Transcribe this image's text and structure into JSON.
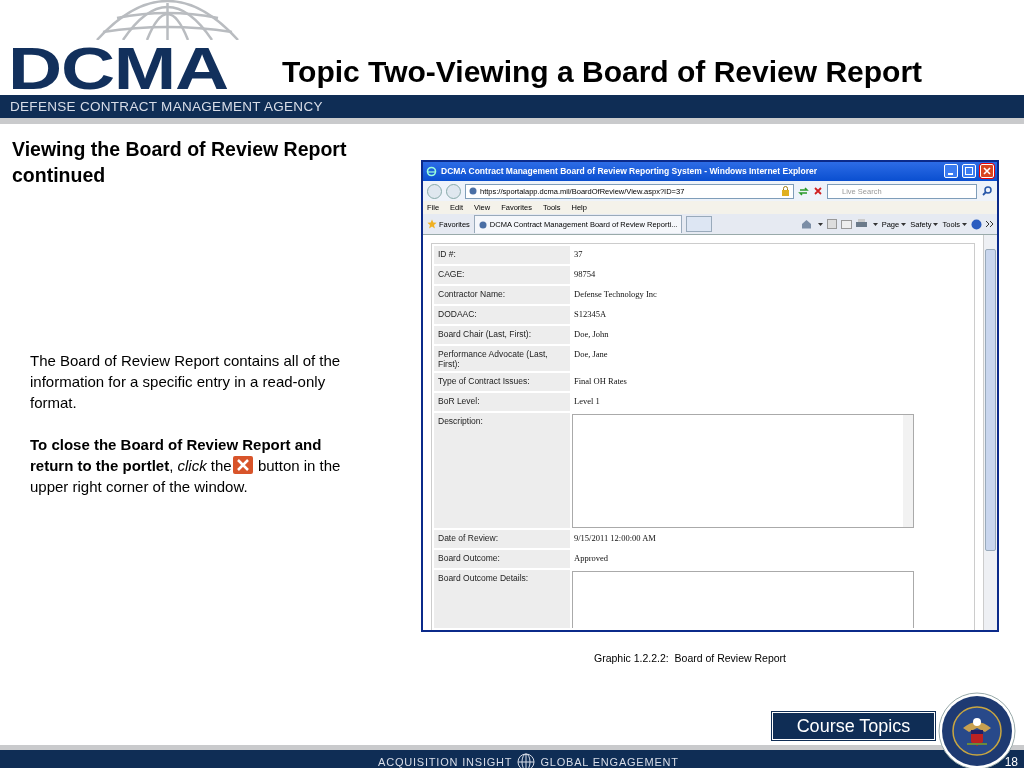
{
  "header": {
    "logo_text": "DCMA",
    "agency": "DEFENSE CONTRACT MANAGEMENT AGENCY",
    "title": "Topic Two-Viewing a Board of Review Report"
  },
  "heading": "Viewing the Board of Review Report continued",
  "intro": "The Board of Review Report contains all of the information for a specific entry in a read-only format.",
  "instruction": {
    "before": [
      "**To close the Board of Review Report and**",
      "**return to the portlet**, *click* the"
    ],
    "after": [
      "button in the",
      "upper right corner of the window."
    ]
  },
  "browser": {
    "title": "DCMA Contract Management Board of Review Reporting System - Windows Internet Explorer",
    "address": "https://sportalapp.dcma.mil/BoardOfReview/View.aspx?ID=37",
    "search_placeholder": "Live Search",
    "menu": [
      "File",
      "Edit",
      "View",
      "Favorites",
      "Tools",
      "Help"
    ],
    "favorites": "Favorites",
    "tab": "DCMA Contract Management Board of Review Reporti...",
    "commands": [
      "Page",
      "Safety",
      "Tools"
    ],
    "fields": [
      {
        "kind": "text",
        "label": "ID #:",
        "value": "37"
      },
      {
        "kind": "text",
        "label": "CAGE:",
        "value": "98754"
      },
      {
        "kind": "text",
        "label": "Contractor Name:",
        "value": "Defense Technology Inc"
      },
      {
        "kind": "text",
        "label": "DODAAC:",
        "value": "S12345A"
      },
      {
        "kind": "text",
        "label": "Board Chair (Last, First):",
        "value": "Doe, John"
      },
      {
        "kind": "text",
        "label": "Performance Advocate (Last, First):",
        "value": "Doe, Jane"
      },
      {
        "kind": "text",
        "label": "Type of Contract Issues:",
        "value": "Final OH Rates"
      },
      {
        "kind": "text",
        "label": "BoR Level:",
        "value": "Level 1"
      },
      {
        "kind": "textarea",
        "label": "Description:"
      },
      {
        "kind": "text",
        "label": "Date of Review:",
        "value": "9/15/2011 12:00:00 AM"
      },
      {
        "kind": "text",
        "label": "Board Outcome:",
        "value": "Approved"
      },
      {
        "kind": "textarea-cut",
        "label": "Board Outcome Details:"
      }
    ]
  },
  "caption": "Graphic 1.2.2.2:  Board of Review Report",
  "course_topics": "Course Topics",
  "footer": {
    "left": "ACQUISITION INSIGHT",
    "right": "GLOBAL ENGAGEMENT",
    "page": "18"
  }
}
